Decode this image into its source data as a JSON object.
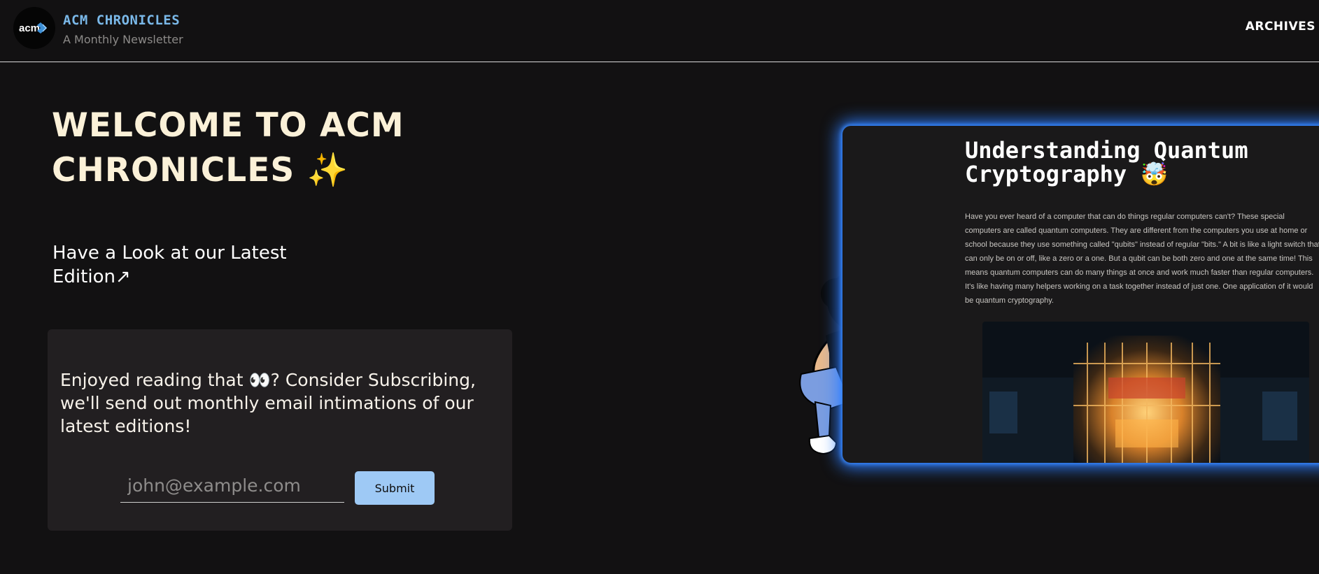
{
  "header": {
    "brand_title": "ACM CHRONICLES",
    "brand_subtitle": "A Monthly Newsletter",
    "logo_text": "acm",
    "nav_archives": "ARCHIVES"
  },
  "hero": {
    "title_line1": "WELCOME TO ACM",
    "title_line2": "CHRONICLES",
    "title_emoji": "✨",
    "latest_link": "Have a Look at our Latest Edition↗"
  },
  "subscribe": {
    "text": "Enjoyed reading that 👀? Consider Subscribing, we'll send out monthly email intimations of our latest editions!",
    "email_placeholder": "john@example.com",
    "submit_label": "Submit"
  },
  "preview": {
    "title": "Understanding Quantum Cryptography 🤯",
    "body": "Have you ever heard of a computer that can do things regular computers can't? These special computers are called quantum computers. They are different from the computers you use at home or school because they use something called \"qubits\" instead of regular \"bits.\" A bit is like a light switch that can only be on or off, like a zero or a one. But a qubit can be both zero and one at the same time! This means quantum computers can do many things at once and work much faster than regular computers. It's like having many helpers working on a task together instead of just one. One application of it would be quantum cryptography."
  },
  "colors": {
    "background": "#121112",
    "brand_blue": "#7ab8e8",
    "hero_cream": "#fbf1d8",
    "card_bg": "#221f21",
    "submit_bg": "#9ec9f5",
    "glow_blue": "#2d7dff"
  },
  "icons": {
    "logo": "acm-logo-icon",
    "sparkle": "sparkles-emoji",
    "arrow": "arrow-up-right-icon"
  }
}
